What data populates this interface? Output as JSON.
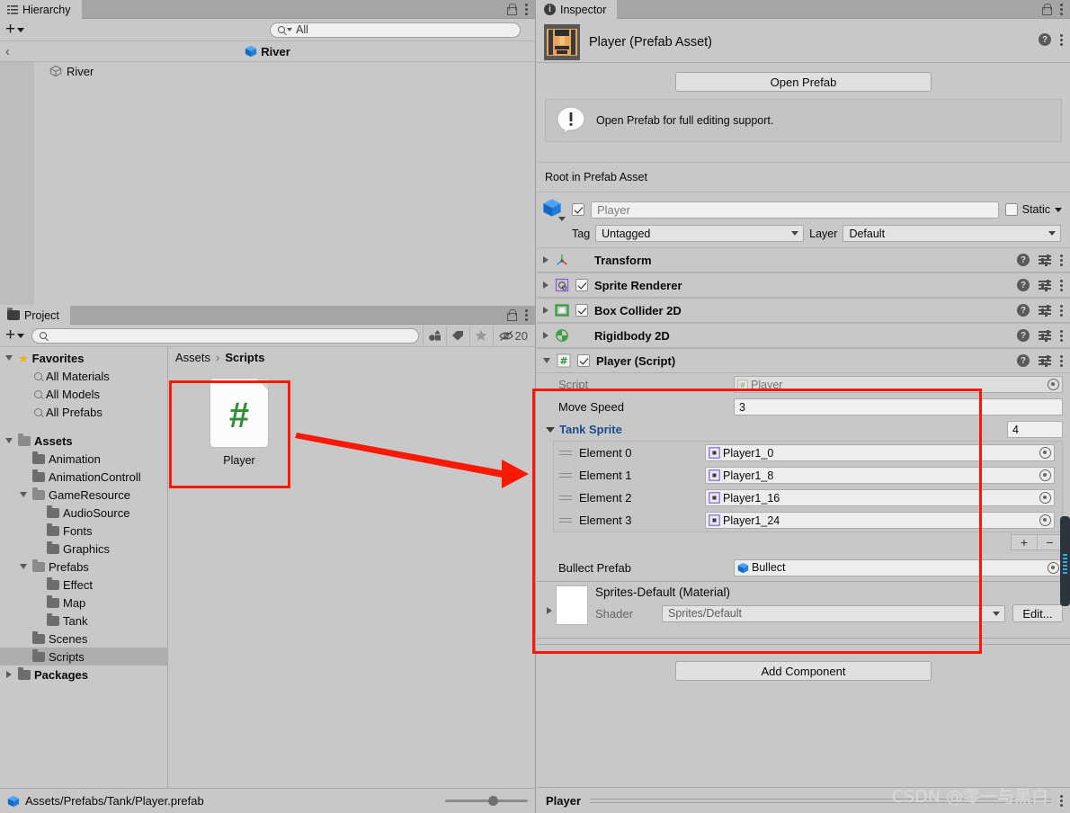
{
  "hierarchy": {
    "tab_label": "Hierarchy",
    "search_placeholder": "All",
    "breadcrumb_title": "River",
    "items": [
      {
        "label": "River"
      }
    ]
  },
  "project": {
    "tab_label": "Project",
    "search_placeholder": "",
    "hidden_count": "20",
    "breadcrumb": {
      "root": "Assets",
      "separator": "›",
      "current": "Scripts"
    },
    "tree": [
      {
        "label": "Favorites",
        "icon": "star-icon",
        "bold": true,
        "depth": 0,
        "twisty": "down"
      },
      {
        "label": "All Materials",
        "icon": "search-icon",
        "bold": false,
        "depth": 1,
        "twisty": "none"
      },
      {
        "label": "All Models",
        "icon": "search-icon",
        "bold": false,
        "depth": 1,
        "twisty": "none"
      },
      {
        "label": "All Prefabs",
        "icon": "search-icon",
        "bold": false,
        "depth": 1,
        "twisty": "none"
      },
      {
        "label": "",
        "icon": "spacer",
        "bold": false,
        "depth": 0,
        "twisty": "none"
      },
      {
        "label": "Assets",
        "icon": "folder-open-icon",
        "bold": true,
        "depth": 0,
        "twisty": "down"
      },
      {
        "label": "Animation",
        "icon": "folder-icon",
        "bold": false,
        "depth": 1,
        "twisty": "none"
      },
      {
        "label": "AnimationControll",
        "icon": "folder-icon",
        "bold": false,
        "depth": 1,
        "twisty": "none"
      },
      {
        "label": "GameResource",
        "icon": "folder-open-icon",
        "bold": false,
        "depth": 1,
        "twisty": "down"
      },
      {
        "label": "AudioSource",
        "icon": "folder-icon",
        "bold": false,
        "depth": 2,
        "twisty": "none"
      },
      {
        "label": "Fonts",
        "icon": "folder-icon",
        "bold": false,
        "depth": 2,
        "twisty": "none"
      },
      {
        "label": "Graphics",
        "icon": "folder-icon",
        "bold": false,
        "depth": 2,
        "twisty": "none"
      },
      {
        "label": "Prefabs",
        "icon": "folder-open-icon",
        "bold": false,
        "depth": 1,
        "twisty": "down"
      },
      {
        "label": "Effect",
        "icon": "folder-icon",
        "bold": false,
        "depth": 2,
        "twisty": "none"
      },
      {
        "label": "Map",
        "icon": "folder-icon",
        "bold": false,
        "depth": 2,
        "twisty": "none"
      },
      {
        "label": "Tank",
        "icon": "folder-icon",
        "bold": false,
        "depth": 2,
        "twisty": "none"
      },
      {
        "label": "Scenes",
        "icon": "folder-icon",
        "bold": false,
        "depth": 1,
        "twisty": "none"
      },
      {
        "label": "Scripts",
        "icon": "folder-icon",
        "bold": false,
        "depth": 1,
        "twisty": "none",
        "selected": true
      },
      {
        "label": "Packages",
        "icon": "folder-icon",
        "bold": true,
        "depth": 0,
        "twisty": "right"
      }
    ],
    "assets": [
      {
        "name": "Player",
        "icon": "csharp-script-icon"
      }
    ],
    "status_path": "Assets/Prefabs/Tank/Player.prefab"
  },
  "inspector": {
    "tab_label": "Inspector",
    "asset_title": "Player (Prefab Asset)",
    "open_prefab_label": "Open Prefab",
    "notice_text": "Open Prefab for full editing support.",
    "root_label": "Root in Prefab Asset",
    "game_object": {
      "name": "Player",
      "enabled": true,
      "static_label": "Static",
      "static_checked": false,
      "tag_label": "Tag",
      "tag_value": "Untagged",
      "layer_label": "Layer",
      "layer_value": "Default"
    },
    "components": [
      {
        "name": "Transform",
        "icon": "transform-icon",
        "has_checkbox": false,
        "expanded": false
      },
      {
        "name": "Sprite Renderer",
        "icon": "sprite-renderer-icon",
        "has_checkbox": true,
        "checked": true,
        "expanded": false
      },
      {
        "name": "Box Collider 2D",
        "icon": "box-collider-2d-icon",
        "has_checkbox": true,
        "checked": true,
        "expanded": false
      },
      {
        "name": "Rigidbody 2D",
        "icon": "rigidbody-2d-icon",
        "has_checkbox": false,
        "expanded": false
      }
    ],
    "script_component": {
      "name": "Player (Script)",
      "icon": "csharp-script-icon",
      "checked": true,
      "expanded": true,
      "script_label": "Script",
      "script_value": "Player",
      "move_speed_label": "Move Speed",
      "move_speed_value": "3",
      "array_label": "Tank Sprite",
      "array_size": "4",
      "elements": [
        {
          "label": "Element 0",
          "value": "Player1_0"
        },
        {
          "label": "Element 1",
          "value": "Player1_8"
        },
        {
          "label": "Element 2",
          "value": "Player1_16"
        },
        {
          "label": "Element 3",
          "value": "Player1_24"
        }
      ],
      "add_btn": "+",
      "remove_btn": "−",
      "bullet_label": "Bullect Prefab",
      "bullet_value": "Bullect"
    },
    "material": {
      "title": "Sprites-Default (Material)",
      "shader_label": "Shader",
      "shader_value": "Sprites/Default",
      "edit_label": "Edit..."
    },
    "add_component_label": "Add Component",
    "status_name": "Player"
  },
  "watermark": "CSDN @零一与黑白",
  "colors": {
    "panel_bg": "#c8c8c8",
    "tabbar_bg": "#a5a5a5",
    "highlight_red": "#fa1905",
    "foldout_blue": "#1a4a8a",
    "script_green": "#2f8f33",
    "prefab_blue": "#1f7fd6"
  }
}
